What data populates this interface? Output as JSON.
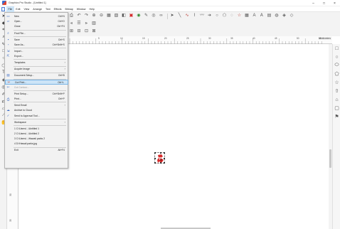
{
  "window": {
    "title": "Graphics Pro Studio - [Untitled 1]",
    "controls": {
      "minimize": "–",
      "maximize": "□",
      "close": "×"
    }
  },
  "menubar": {
    "items": [
      "File",
      "Edit",
      "View",
      "Arrange",
      "Text",
      "Effects",
      "Bitmap",
      "Window",
      "Help"
    ],
    "active_index": 0
  },
  "file_menu": {
    "items": [
      {
        "label": "New",
        "shortcut": "Ctrl+N",
        "icon": "new-document-icon"
      },
      {
        "label": "Open...",
        "shortcut": "Ctrl+O",
        "icon": "open-folder-icon"
      },
      {
        "label": "Close",
        "shortcut": "Ctrl+F4"
      },
      {
        "separator": true
      },
      {
        "label": "Find File...",
        "icon": "find-file-icon"
      },
      {
        "separator": true
      },
      {
        "label": "Save",
        "shortcut": "Ctrl+S",
        "icon": "save-icon"
      },
      {
        "label": "Save As...",
        "shortcut": "Ctrl+Shift+S",
        "icon": "save-as-icon"
      },
      {
        "separator": true
      },
      {
        "label": "Import...",
        "icon": "import-icon"
      },
      {
        "label": "Export...",
        "icon": "export-icon"
      },
      {
        "separator": true
      },
      {
        "label": "Templates",
        "submenu": true
      },
      {
        "separator": true
      },
      {
        "label": "Acquire Image",
        "submenu": true
      },
      {
        "separator": true
      },
      {
        "label": "Document Setup...",
        "shortcut": "Ctrl+B",
        "icon": "document-setup-icon"
      },
      {
        "separator": true
      },
      {
        "label": "Cut Print...",
        "shortcut": "Ctrl+L",
        "icon": "cut-print-icon",
        "highlight": true
      },
      {
        "label": "Cut Contour...",
        "disabled": true,
        "icon": "cut-contour-icon"
      },
      {
        "separator": true
      },
      {
        "label": "Print Setup...",
        "shortcut": "Ctrl+Shift+P"
      },
      {
        "label": "Print...",
        "shortcut": "Ctrl+P",
        "icon": "print-icon"
      },
      {
        "separator": true
      },
      {
        "label": "Send Email",
        "submenu": true
      },
      {
        "label": "Archive to Cloud",
        "icon": "cloud-icon"
      },
      {
        "label": "Send to Approval Tool...",
        "icon": "approval-icon"
      },
      {
        "separator": true
      },
      {
        "label": "Workspace",
        "submenu": true
      },
      {
        "separator": true
      },
      {
        "label": "1 C:\\Users\\...\\Untitled 1"
      },
      {
        "label": "2 C:\\Users\\...\\Untitled 2"
      },
      {
        "label": "3 C:\\Users\\...\\Hawaii parks 2"
      },
      {
        "label": "4 D:\\Hawaii parks.jpg"
      },
      {
        "separator": true
      },
      {
        "label": "Exit",
        "shortcut": "Alt+F4"
      }
    ]
  },
  "ruler": {
    "units": "centimeters",
    "top_ticks": [
      "5",
      "10",
      "15",
      "20",
      "25",
      "30",
      "35",
      "40",
      "45",
      "50",
      "55"
    ],
    "left_ticks": [
      "30",
      "35"
    ]
  },
  "icons": {
    "toolbar_row1": [
      "print-icon",
      "undo-icon",
      "redo-icon",
      "zoom-in-icon",
      "zoom-out-icon",
      "group-icon",
      "ungroup-icon",
      "combine-icon",
      "fill-icon",
      "color-icon",
      "eyedropper-icon",
      "view-icon",
      "link-icon",
      "pointer-icon",
      "line-icon",
      "curve-icon",
      "bezier-icon",
      "freehand-icon",
      "arrow-icon",
      "circle-icon",
      "polygon-icon",
      "spiral-icon",
      "star-icon",
      "grid-icon",
      "text-icon",
      "fit-text-icon",
      "table-icon",
      "spiral2-icon",
      "shape-icon",
      "contour-icon"
    ],
    "toolbar_row2": [
      "align-left-icon",
      "align-center-icon",
      "align-right-icon",
      "distribute-icon"
    ],
    "toolbar_row3": [
      "snap-icon",
      "grid-snap-icon",
      "guide-icon",
      "rulers-icon"
    ],
    "left_palette": [
      "pick-icon",
      "shape-tool-icon",
      "crop-icon",
      "zoom-tool-icon",
      "freehand-tool-icon",
      "rectangle-tool-icon",
      "ellipse-tool-icon",
      "polygon-tool-icon",
      "text-tool-icon",
      "fill-tool-icon",
      "outline-tool-icon",
      "eyedropper-tool-icon",
      "interactive-tool-icon",
      "eraser-tool-icon",
      "knife-tool-icon",
      "hand-tool-icon"
    ],
    "right_palette": [
      "rectangle-shape-icon",
      "ellipse-shape-icon",
      "oval-shape-icon",
      "pentagon-shape-icon",
      "star-shape-icon",
      "arrow-shape-icon",
      "house-shape-icon",
      "frame-shape-icon",
      "banner-shape-icon"
    ]
  },
  "colors": {
    "menu_highlight": "#cce4f7",
    "object_red": "#d42a2a"
  }
}
